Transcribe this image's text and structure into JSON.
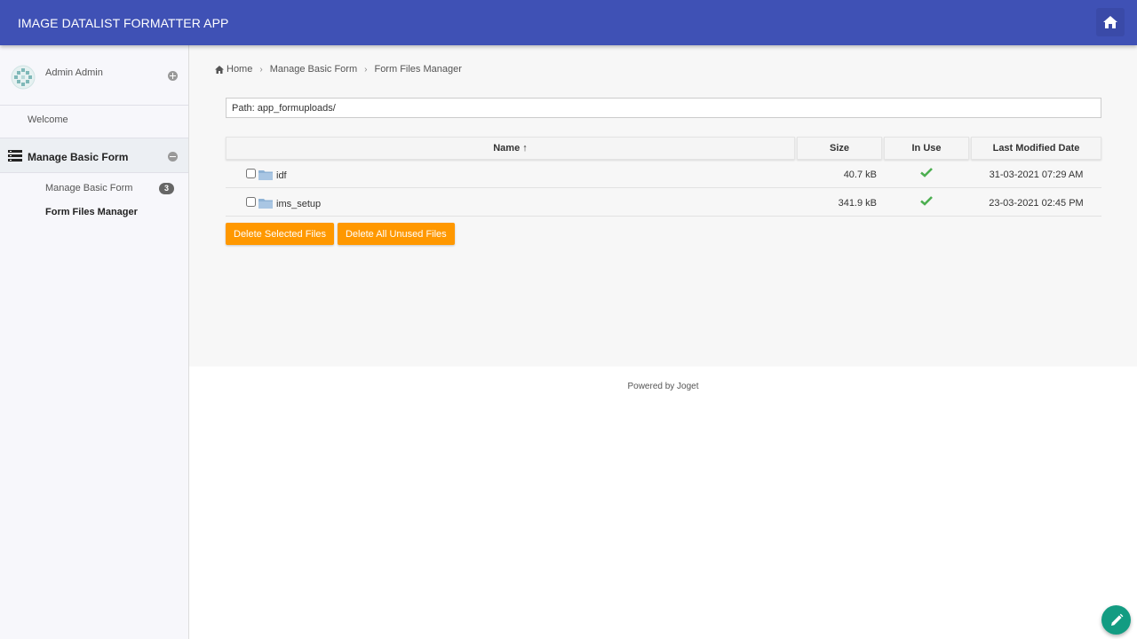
{
  "header": {
    "app_title": "IMAGE DATALIST FORMATTER APP",
    "home_icon": "home-icon"
  },
  "sidebar": {
    "user_name": "Admin Admin",
    "welcome": "Welcome",
    "group_label": "Manage Basic Form",
    "items": [
      {
        "label": "Manage Basic Form",
        "badge": "3"
      },
      {
        "label": "Form Files Manager"
      }
    ]
  },
  "breadcrumb": {
    "items": [
      "Home",
      "Manage Basic Form",
      "Form Files Manager"
    ]
  },
  "path": "Path: app_formuploads/",
  "table": {
    "columns": [
      "Name ↑",
      "Size",
      "In Use",
      "Last Modified Date"
    ],
    "rows": [
      {
        "name": "idf",
        "size": "40.7 kB",
        "in_use": true,
        "date": "31-03-2021 07:29 AM"
      },
      {
        "name": "ims_setup",
        "size": "341.9 kB",
        "in_use": true,
        "date": "23-03-2021 02:45 PM"
      }
    ]
  },
  "actions": {
    "delete_selected": "Delete Selected Files",
    "delete_unused": "Delete All Unused Files"
  },
  "footer": "Powered by Joget",
  "colors": {
    "header_bg": "#3f51b5",
    "button_bg": "#ff9800",
    "fab_bg": "#139c82",
    "check": "#4caf50"
  }
}
